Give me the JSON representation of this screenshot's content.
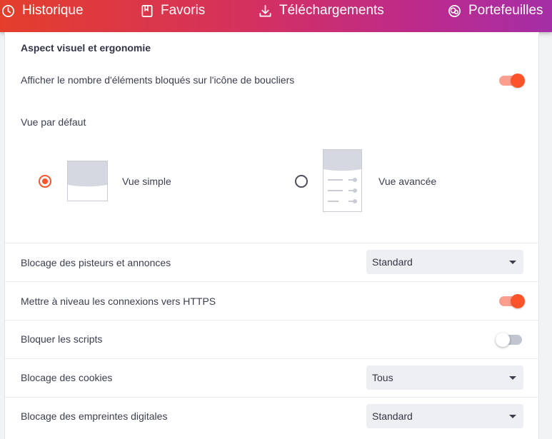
{
  "nav": {
    "items": [
      {
        "label": "Historique",
        "icon": "history-icon"
      },
      {
        "label": "Favoris",
        "icon": "bookmark-icon"
      },
      {
        "label": "Téléchargements",
        "icon": "download-icon"
      },
      {
        "label": "Portefeuilles",
        "icon": "wallet-icon"
      }
    ]
  },
  "section": {
    "title": "Aspect visuel et ergonomie",
    "shield_count_label": "Afficher le nombre d'éléments bloqués sur l'icône de boucliers",
    "shield_count_enabled": true,
    "default_view_label": "Vue par défaut",
    "views": [
      {
        "label": "Vue simple",
        "selected": true
      },
      {
        "label": "Vue avancée",
        "selected": false
      }
    ]
  },
  "settings": {
    "trackers": {
      "label": "Blocage des pisteurs et annonces",
      "value": "Standard"
    },
    "https": {
      "label": "Mettre à niveau les connexions vers HTTPS",
      "enabled": true
    },
    "scripts": {
      "label": "Bloquer les scripts",
      "enabled": false
    },
    "cookies": {
      "label": "Blocage des cookies",
      "value": "Tous"
    },
    "fingerprint": {
      "label": "Blocage des empreintes digitales",
      "value": "Standard"
    }
  },
  "colors": {
    "accent": "#fb542b",
    "toggle_track_on": "#fa9e8e",
    "toggle_track_off": "#c2c4cf"
  }
}
